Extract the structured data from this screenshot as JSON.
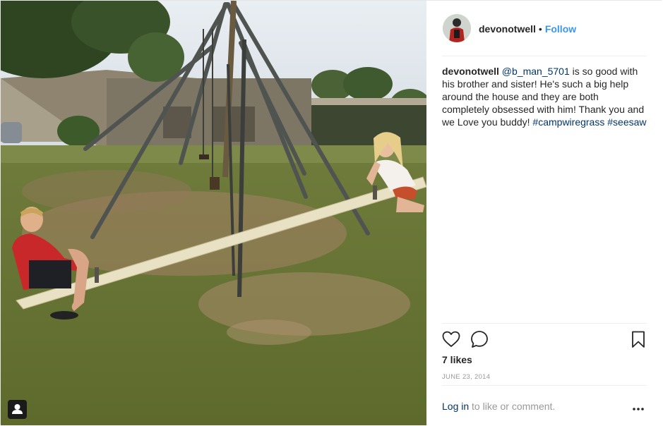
{
  "post": {
    "username": "devonotwell",
    "bullet": "•",
    "follow_label": "Follow",
    "caption": {
      "username": "devonotwell",
      "mention": "@b_man_5701",
      "text": "is so good with his brother and sister! He's such a big help around the house and they are both completely obsessed with him! Thank you and we Love you buddy!",
      "hashtags": [
        "#campwiregrass",
        "#seesaw"
      ]
    },
    "likes_label": "7 likes",
    "date": "JUNE 23, 2014",
    "login_link": "Log in",
    "login_suffix": "to like or comment."
  },
  "icons": {
    "like": "heart-icon",
    "comment": "comment-bubble-icon",
    "save": "bookmark-icon",
    "more": "more-options-icon",
    "tagged": "tagged-user-icon"
  },
  "colors": {
    "link_blue": "#3897f0",
    "hashtag_blue": "#003569",
    "text": "#262626",
    "muted": "#999999"
  }
}
